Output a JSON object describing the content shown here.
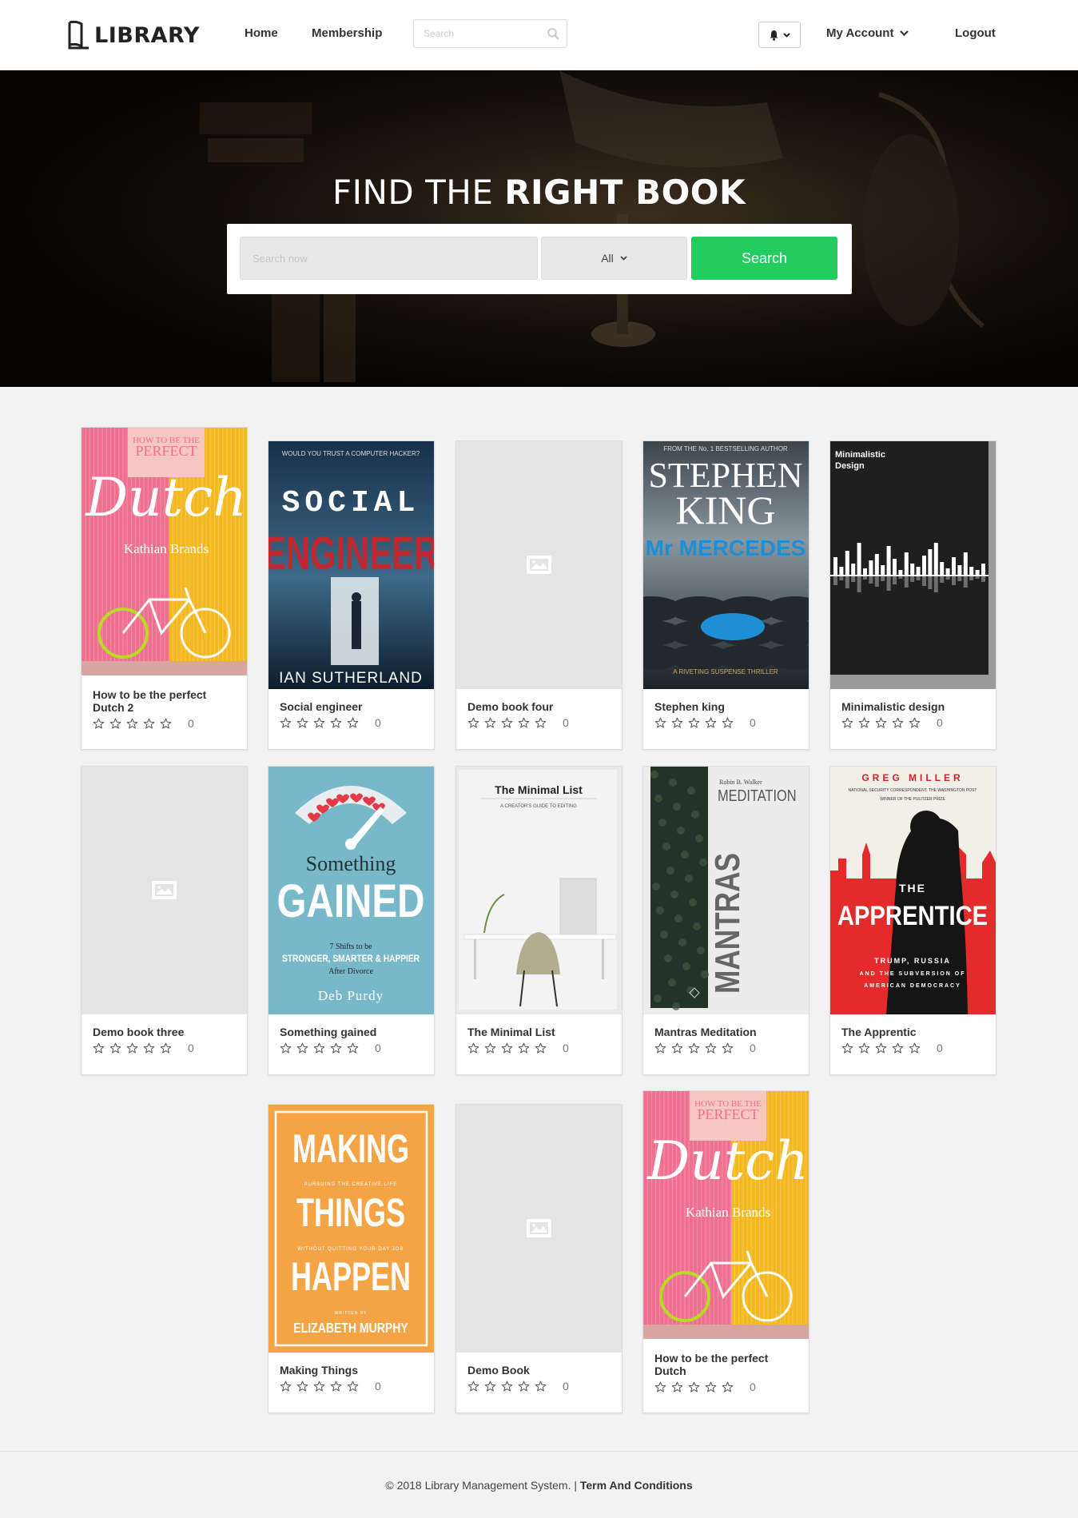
{
  "header": {
    "logo_text": "LIBRARY",
    "nav": {
      "home": "Home",
      "membership": "Membership"
    },
    "search_placeholder": "Search",
    "account_label": "My Account",
    "logout_label": "Logout"
  },
  "hero": {
    "title_light": "FIND THE",
    "title_bold": "RIGHT BOOK",
    "search_placeholder": "Search now",
    "category_selected": "All",
    "search_button": "Search"
  },
  "books": [
    {
      "title": "How to be the perfect Dutch 2",
      "rating": 0,
      "count": "0",
      "cover": "dutch"
    },
    {
      "title": "Social engineer",
      "rating": 0,
      "count": "0",
      "cover": "social"
    },
    {
      "title": "Demo book four",
      "rating": 0,
      "count": "0",
      "cover": "placeholder"
    },
    {
      "title": "Stephen king",
      "rating": 0,
      "count": "0",
      "cover": "king"
    },
    {
      "title": "Minimalistic design",
      "rating": 0,
      "count": "0",
      "cover": "minimal_design"
    },
    {
      "title": "Demo book three",
      "rating": 0,
      "count": "0",
      "cover": "placeholder"
    },
    {
      "title": "Something gained",
      "rating": 0,
      "count": "0",
      "cover": "gained"
    },
    {
      "title": "The Minimal List",
      "rating": 0,
      "count": "0",
      "cover": "minimal_list"
    },
    {
      "title": "Mantras Meditation",
      "rating": 0,
      "count": "0",
      "cover": "mantras"
    },
    {
      "title": "The Apprentic",
      "rating": 0,
      "count": "0",
      "cover": "apprentice"
    },
    {
      "title": "Making Things",
      "rating": 0,
      "count": "0",
      "cover": "making"
    },
    {
      "title": "Demo Book",
      "rating": 0,
      "count": "0",
      "cover": "placeholder"
    },
    {
      "title": "How to be the perfect Dutch",
      "rating": 0,
      "count": "0",
      "cover": "dutch"
    }
  ],
  "covers": {
    "dutch": {
      "top": "HOW TO BE THE",
      "top2": "PERFECT",
      "script": "Dutch",
      "author": "Kathian Brands"
    },
    "social": {
      "tagline": "WOULD YOU TRUST A COMPUTER HACKER?",
      "line1": "SOCIAL",
      "line2": "ENGINEER",
      "author": "IAN SUTHERLAND"
    },
    "king": {
      "tagline": "FROM THE No. 1 BESTSELLING AUTHOR",
      "line1": "STEPHEN",
      "line2": "KING",
      "subtitle": "Mr MERCEDES",
      "bottom": "A RIVETING SUSPENSE THRILLER"
    },
    "minimal_design": {
      "line1": "Minimalistic",
      "line2": "Design"
    },
    "gained": {
      "line1": "Something",
      "line2": "GAINED",
      "sub1": "7 Shifts to be",
      "sub2": "STRONGER, SMARTER & HAPPIER",
      "sub3": "After Divorce",
      "author": "Deb Purdy"
    },
    "minimal_list": {
      "title": "The Minimal List",
      "sub": "A CREATOR'S GUIDE TO EDITING"
    },
    "mantras": {
      "author": "Robin B. Walker",
      "line1": "MEDITATION",
      "line2": "MANTRAS"
    },
    "apprentice": {
      "author": "GREG MILLER",
      "note1": "NATIONAL SECURITY CORRESPONDENT, THE WASHINGTON POST",
      "note2": "WINNER OF THE PULITZER PRIZE",
      "the": "THE",
      "title": "APPRENTICE",
      "sub1": "TRUMP, RUSSIA",
      "sub2": "AND THE SUBVERSION OF",
      "sub3": "AMERICAN DEMOCRACY"
    },
    "making": {
      "l1": "MAKING",
      "s1": "PURSUING THE CREATIVE LIFE",
      "l2": "THINGS",
      "s2": "WITHOUT QUITTING YOUR DAY JOB",
      "l3": "HAPPEN",
      "s3": "WRITTEN BY",
      "author": "ELIZABETH MURPHY"
    }
  },
  "footer": {
    "copyright": "© 2018 Library Management System. |",
    "terms": "Term And Conditions"
  }
}
